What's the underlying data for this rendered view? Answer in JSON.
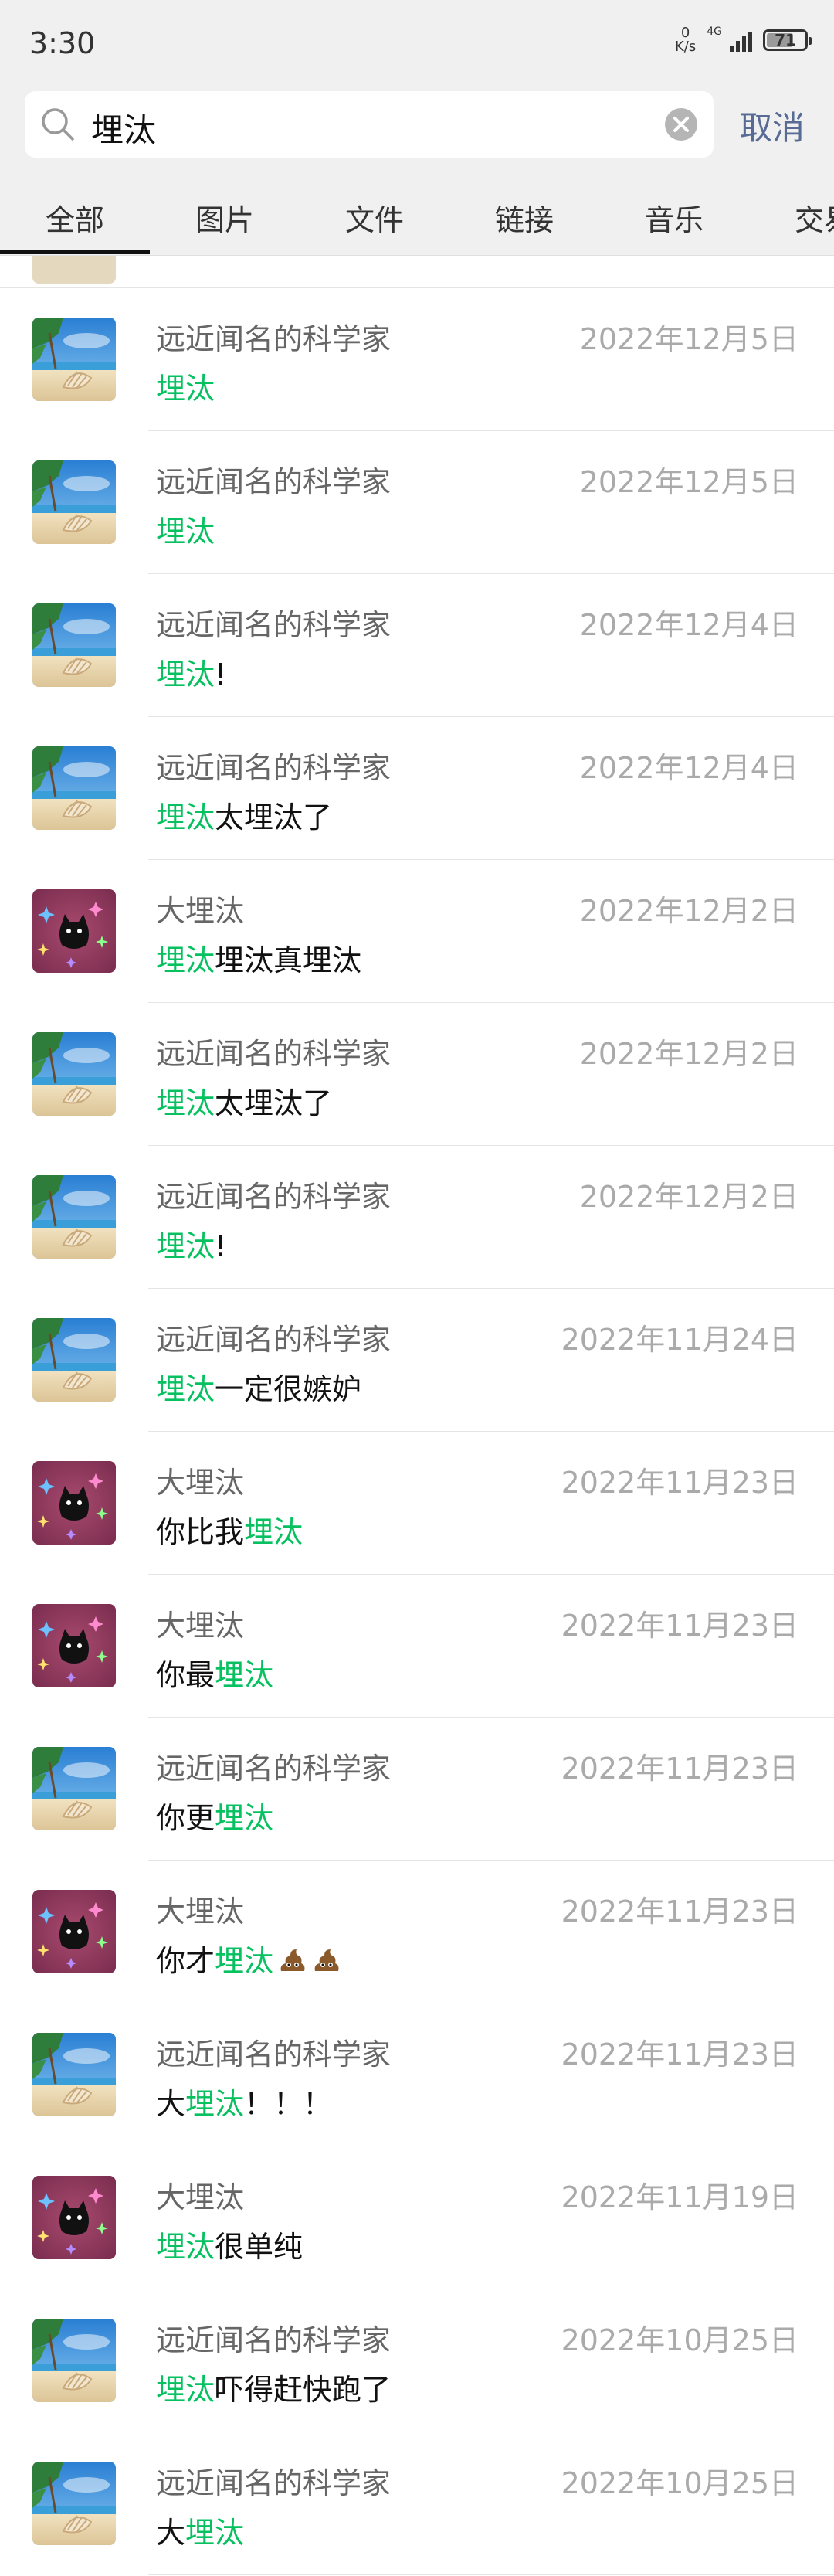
{
  "status_bar": {
    "time": "3:30",
    "speed_value": "0",
    "speed_unit": "K/s",
    "network": "4G",
    "battery": "71"
  },
  "search": {
    "query": "埋汰",
    "cancel_label": "取消"
  },
  "tabs": [
    "全部",
    "图片",
    "文件",
    "链接",
    "音乐",
    "交易"
  ],
  "active_tab": "全部",
  "results": [
    {
      "avatar": "beach",
      "name": "远近闻名的科学家",
      "date": "2022年12月5日",
      "msg": [
        {
          "t": "埋汰",
          "h": true
        }
      ]
    },
    {
      "avatar": "beach",
      "name": "远近闻名的科学家",
      "date": "2022年12月5日",
      "msg": [
        {
          "t": "埋汰",
          "h": true
        }
      ]
    },
    {
      "avatar": "beach",
      "name": "远近闻名的科学家",
      "date": "2022年12月4日",
      "msg": [
        {
          "t": "埋汰",
          "h": true
        },
        {
          "t": "!",
          "h": false
        }
      ]
    },
    {
      "avatar": "beach",
      "name": "远近闻名的科学家",
      "date": "2022年12月4日",
      "msg": [
        {
          "t": "埋汰",
          "h": true
        },
        {
          "t": "太埋汰了",
          "h": false
        }
      ]
    },
    {
      "avatar": "cat",
      "name": "大埋汰",
      "date": "2022年12月2日",
      "msg": [
        {
          "t": "埋汰",
          "h": true
        },
        {
          "t": "埋汰真埋汰",
          "h": false
        }
      ]
    },
    {
      "avatar": "beach",
      "name": "远近闻名的科学家",
      "date": "2022年12月2日",
      "msg": [
        {
          "t": "埋汰",
          "h": true
        },
        {
          "t": "太埋汰了",
          "h": false
        }
      ]
    },
    {
      "avatar": "beach",
      "name": "远近闻名的科学家",
      "date": "2022年12月2日",
      "msg": [
        {
          "t": "埋汰",
          "h": true
        },
        {
          "t": "!",
          "h": false
        }
      ]
    },
    {
      "avatar": "beach",
      "name": "远近闻名的科学家",
      "date": "2022年11月24日",
      "msg": [
        {
          "t": "埋汰",
          "h": true
        },
        {
          "t": "一定很嫉妒",
          "h": false
        }
      ]
    },
    {
      "avatar": "cat",
      "name": "大埋汰",
      "date": "2022年11月23日",
      "msg": [
        {
          "t": "你比我",
          "h": false
        },
        {
          "t": "埋汰",
          "h": true
        }
      ]
    },
    {
      "avatar": "cat",
      "name": "大埋汰",
      "date": "2022年11月23日",
      "msg": [
        {
          "t": "你最",
          "h": false
        },
        {
          "t": "埋汰",
          "h": true
        }
      ]
    },
    {
      "avatar": "beach",
      "name": "远近闻名的科学家",
      "date": "2022年11月23日",
      "msg": [
        {
          "t": "你更",
          "h": false
        },
        {
          "t": "埋汰",
          "h": true
        }
      ]
    },
    {
      "avatar": "cat",
      "name": "大埋汰",
      "date": "2022年11月23日",
      "msg": [
        {
          "t": "你才",
          "h": false
        },
        {
          "t": "埋汰",
          "h": true
        }
      ],
      "emojis": 2
    },
    {
      "avatar": "beach",
      "name": "远近闻名的科学家",
      "date": "2022年11月23日",
      "msg": [
        {
          "t": "大",
          "h": false
        },
        {
          "t": "埋汰",
          "h": true
        },
        {
          "t": "！！！",
          "h": false
        }
      ]
    },
    {
      "avatar": "cat",
      "name": "大埋汰",
      "date": "2022年11月19日",
      "msg": [
        {
          "t": "埋汰",
          "h": true
        },
        {
          "t": "很单纯",
          "h": false
        }
      ]
    },
    {
      "avatar": "beach",
      "name": "远近闻名的科学家",
      "date": "2022年10月25日",
      "msg": [
        {
          "t": "埋汰",
          "h": true
        },
        {
          "t": "吓得赶快跑了",
          "h": false
        }
      ]
    },
    {
      "avatar": "beach",
      "name": "远近闻名的科学家",
      "date": "2022年10月25日",
      "msg": [
        {
          "t": "大",
          "h": false
        },
        {
          "t": "埋汰",
          "h": true
        }
      ]
    }
  ]
}
